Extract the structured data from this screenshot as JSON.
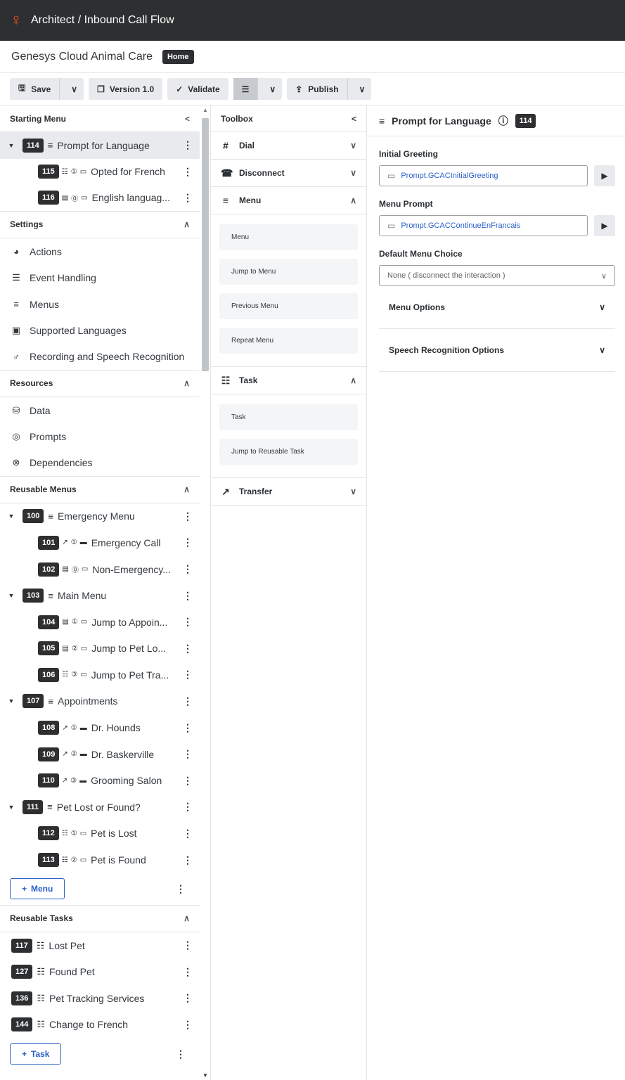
{
  "app": {
    "title": "Architect / Inbound Call Flow",
    "org": "Genesys Cloud Animal Care",
    "home_badge": "Home"
  },
  "toolbar": {
    "save": "Save",
    "version": "Version 1.0",
    "validate": "Validate",
    "publish": "Publish"
  },
  "starting_menu": {
    "title": "Starting Menu",
    "root": {
      "id": "114",
      "label": "Prompt for Language"
    },
    "children": [
      {
        "id": "115",
        "label": "Opted for French",
        "key": "1"
      },
      {
        "id": "116",
        "label": "English languag...",
        "key": "0"
      }
    ]
  },
  "settings": {
    "title": "Settings",
    "items": [
      "Actions",
      "Event Handling",
      "Menus",
      "Supported Languages",
      "Recording and Speech Recognition"
    ]
  },
  "resources": {
    "title": "Resources",
    "items": [
      "Data",
      "Prompts",
      "Dependencies"
    ]
  },
  "reusable_menus": {
    "title": "Reusable Menus",
    "groups": [
      {
        "id": "100",
        "label": "Emergency Menu",
        "children": [
          {
            "id": "101",
            "label": "Emergency Call",
            "key": "1"
          },
          {
            "id": "102",
            "label": "Non-Emergency...",
            "key": "0"
          }
        ]
      },
      {
        "id": "103",
        "label": "Main Menu",
        "children": [
          {
            "id": "104",
            "label": "Jump to Appoin...",
            "key": "1"
          },
          {
            "id": "105",
            "label": "Jump to Pet Lo...",
            "key": "2"
          },
          {
            "id": "106",
            "label": "Jump to Pet Tra...",
            "key": "3"
          }
        ]
      },
      {
        "id": "107",
        "label": "Appointments",
        "children": [
          {
            "id": "108",
            "label": "Dr. Hounds",
            "key": "1"
          },
          {
            "id": "109",
            "label": "Dr. Baskerville",
            "key": "2"
          },
          {
            "id": "110",
            "label": "Grooming Salon",
            "key": "3"
          }
        ]
      },
      {
        "id": "111",
        "label": "Pet Lost or Found?",
        "children": [
          {
            "id": "112",
            "label": "Pet is Lost",
            "key": "1"
          },
          {
            "id": "113",
            "label": "Pet is Found",
            "key": "2"
          }
        ]
      }
    ],
    "add_label": "Menu"
  },
  "reusable_tasks": {
    "title": "Reusable Tasks",
    "items": [
      {
        "id": "117",
        "label": "Lost Pet"
      },
      {
        "id": "127",
        "label": "Found Pet"
      },
      {
        "id": "136",
        "label": "Pet Tracking Services"
      },
      {
        "id": "144",
        "label": "Change to French"
      }
    ],
    "add_label": "Task"
  },
  "toolbox": {
    "title": "Toolbox",
    "dial": "Dial",
    "disconnect": "Disconnect",
    "menu": "Menu",
    "menu_tiles": [
      "Menu",
      "Jump to Menu",
      "Previous Menu",
      "Repeat Menu"
    ],
    "task": "Task",
    "task_tiles": [
      "Task",
      "Jump to Reusable Task"
    ],
    "transfer": "Transfer"
  },
  "detail": {
    "title": "Prompt for Language",
    "id": "114",
    "initial_greeting_label": "Initial Greeting",
    "initial_greeting_value": "Prompt.GCACInitialGreeting",
    "menu_prompt_label": "Menu Prompt",
    "menu_prompt_value": "Prompt.GCACContinueEnFrancais",
    "default_choice_label": "Default Menu Choice",
    "default_choice_value": "None ( disconnect the interaction )",
    "menu_options": "Menu Options",
    "speech_options": "Speech Recognition Options"
  }
}
